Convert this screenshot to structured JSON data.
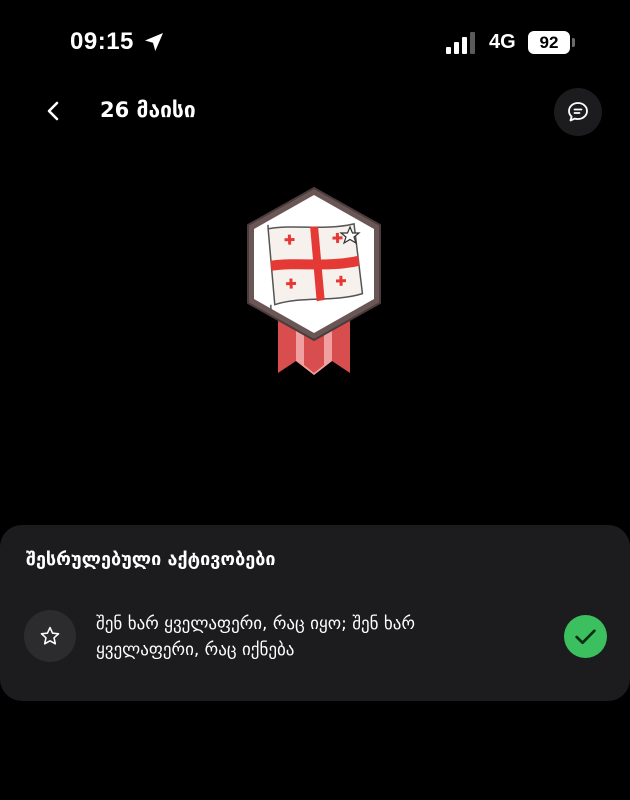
{
  "status_bar": {
    "time": "09:15",
    "network": "4G",
    "battery": "92",
    "icons": [
      "location-arrow-icon",
      "signal-bars-icon"
    ]
  },
  "header": {
    "title": "26 მაისი",
    "back_icon": "chevron-left-icon",
    "action_icon": "chat-bubble-icon"
  },
  "badge": {
    "icon": "georgian-flag-badge-icon",
    "colors": {
      "frame": "#5a4a4a",
      "flag_red": "#e53935",
      "ribbon": "#e05a5a"
    }
  },
  "activities": {
    "title": "შესრულებული აქტივობები",
    "items": [
      {
        "icon": "star-icon",
        "text": "შენ ხარ ყველაფერი, რაც იყო; შენ ხარ ყველაფერი, რაც იქნება",
        "status_icon": "check-icon",
        "status_color": "#3cc05f"
      }
    ]
  }
}
